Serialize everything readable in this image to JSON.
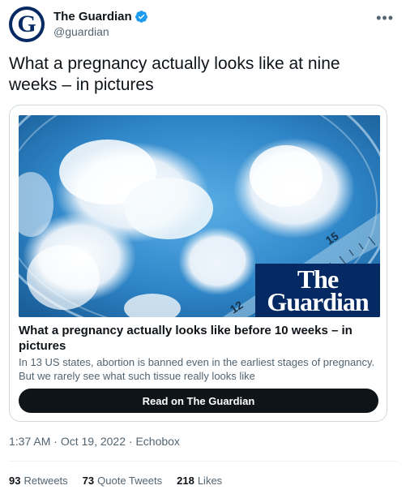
{
  "account": {
    "display_name": "The Guardian",
    "handle": "@guardian",
    "avatar_letter": "G"
  },
  "tweet": {
    "text": "What a pregnancy actually looks like at nine weeks – in pictures"
  },
  "card": {
    "logo_line1": "The",
    "logo_line2": "Guardian",
    "ruler_labels": [
      "15",
      "12"
    ],
    "title": "What a pregnancy actually looks like before 10 weeks – in pictures",
    "description": "In 13 US states, abortion is banned even in the earliest stages of pregnancy. But we rarely see what such tissue really looks like",
    "button_label": "Read on The Guardian"
  },
  "meta": {
    "time": "1:37 AM",
    "date": "Oct 19, 2022",
    "source": "Echobox",
    "separator": "·"
  },
  "stats": {
    "retweets_count": "93",
    "retweets_label": "Retweets",
    "quotes_count": "73",
    "quotes_label": "Quote Tweets",
    "likes_count": "218",
    "likes_label": "Likes"
  },
  "colors": {
    "brand": "#052962",
    "verified": "#1d9bf0",
    "button": "#0f1419",
    "muted_text": "#536471"
  },
  "icons": {
    "verified": "verified-badge-icon",
    "more": "more-options-icon"
  }
}
